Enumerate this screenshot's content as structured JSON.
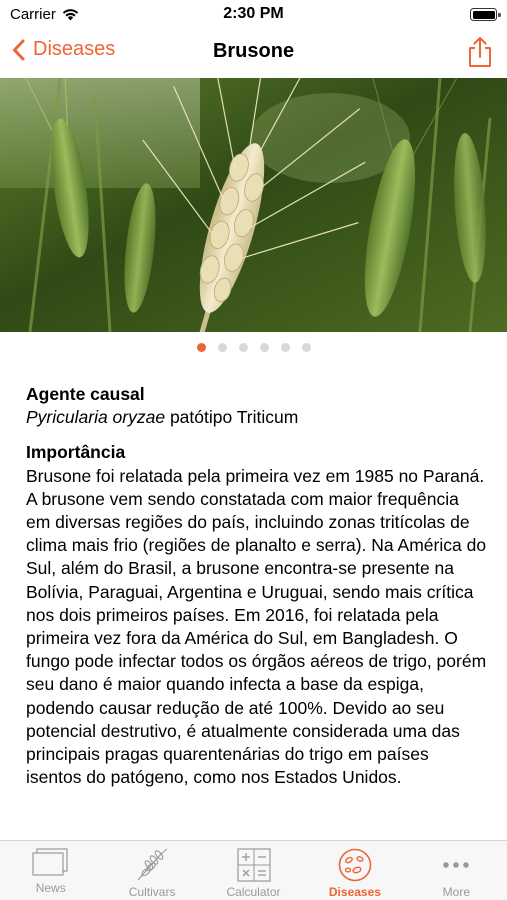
{
  "status_bar": {
    "carrier": "Carrier",
    "time": "2:30 PM",
    "battery_level": 1.0
  },
  "nav": {
    "back_label": "Diseases",
    "title": "Brusone",
    "share_icon": "share-icon"
  },
  "gallery": {
    "page_count": 6,
    "current_page": 1
  },
  "content": {
    "agent_heading": "Agente causal",
    "agent_species": "Pyricularia oryzae",
    "agent_rest": " patótipo Triticum",
    "importance_heading": "Importância",
    "importance_text": "Brusone foi relatada pela primeira vez em 1985 no Paraná. A brusone vem sendo constatada com maior frequência em diversas regiões do país, incluindo zonas tritícolas de clima mais frio (regiões de planalto e serra). Na América do Sul, além do Brasil, a brusone encontra-se presente na Bolívia, Paraguai, Argentina e Uruguai, sendo mais crítica nos dois primeiros países. Em 2016, foi relatada pela primeira vez fora da América do Sul, em Bangladesh. O fungo pode infectar todos os órgãos aéreos de trigo, porém seu dano é maior quando infecta a base da espiga, podendo causar redução de até 100%. Devido ao seu potencial destrutivo, é atualmente considerada uma das principais pragas quarentenárias do trigo em países isentos do patógeno, como nos Estados Unidos."
  },
  "tabs": [
    {
      "label": "News",
      "icon": "news-icon"
    },
    {
      "label": "Cultivars",
      "icon": "wheat-icon"
    },
    {
      "label": "Calculator",
      "icon": "calculator-icon"
    },
    {
      "label": "Diseases",
      "icon": "diseases-icon",
      "active": true
    },
    {
      "label": "More",
      "icon": "more-icon"
    }
  ],
  "colors": {
    "accent": "#ef6436",
    "tab_inactive": "#9a9a9a",
    "dot_inactive": "#d8d8d8"
  }
}
